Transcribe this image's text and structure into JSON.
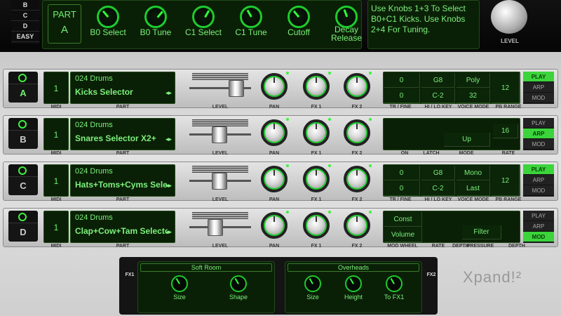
{
  "top": {
    "part_letters": [
      "B",
      "C",
      "D",
      "EASY"
    ],
    "part_label": "PART",
    "part_value": "A",
    "knobs": [
      {
        "label": "B0 Select",
        "angle": -40
      },
      {
        "label": "B0 Tune",
        "angle": 40
      },
      {
        "label": "C1 Select",
        "angle": 30
      },
      {
        "label": "C1 Tune",
        "angle": -30
      },
      {
        "label": "Cutoff",
        "angle": -40
      },
      {
        "label": "Decay\nRelease",
        "angle": -20
      }
    ],
    "message": "Use Knobs 1+3 To Select B0+C1 Kicks. Use Knobs 2+4 For Tuning.",
    "level_label": "LEVEL"
  },
  "rows": [
    {
      "letter": "A",
      "active": true,
      "midi": "1",
      "bank": "024 Drums",
      "part": "Kicks Selector",
      "mode": "play",
      "ctl": {
        "type": "play",
        "tr": [
          "0",
          "0"
        ],
        "hilo": [
          "G8",
          "C-2"
        ],
        "voice": [
          "Poly",
          "32"
        ],
        "pb": "12"
      },
      "labels": {
        "a": "TR / FINE",
        "b": "HI / LO KEY",
        "c": "VOICE MODE",
        "d": "PB RANGE"
      }
    },
    {
      "letter": "B",
      "active": false,
      "midi": "1",
      "bank": "024 Drums",
      "part": "Snares Selector X2+",
      "mode": "arp",
      "ctl": {
        "type": "arp",
        "arp_mode": "Up",
        "rate": "16"
      },
      "labels": {
        "a": "ON",
        "b": "LATCH",
        "c": "MODE",
        "d": "RATE"
      }
    },
    {
      "letter": "C",
      "active": false,
      "midi": "1",
      "bank": "024 Drums",
      "part": "Hats+Toms+Cyms Selector",
      "mode": "play",
      "ctl": {
        "type": "play",
        "tr": [
          "0",
          "0"
        ],
        "hilo": [
          "G8",
          "C-2"
        ],
        "voice": [
          "Mono",
          "Last"
        ],
        "pb": "12"
      },
      "labels": {
        "a": "TR / FINE",
        "b": "HI / LO KEY",
        "c": "VOICE MODE",
        "d": "PB RANGE"
      }
    },
    {
      "letter": "D",
      "active": false,
      "midi": "1",
      "bank": "024 Drums",
      "part": "Clap+Cow+Tam Selector",
      "mode": "mod",
      "ctl": {
        "type": "mod",
        "mw": [
          "Const",
          "Volume"
        ],
        "filter": "Filter"
      },
      "labels": {
        "a": "MOD WHEEL",
        "b": "RATE",
        "c": "DEPTH",
        "d": "PRESSURE",
        "e": "DEPTH"
      }
    }
  ],
  "strip_labels": {
    "midi": "MIDI",
    "part": "PART",
    "level": "LEVEL",
    "pan": "PAN",
    "fx1": "FX 1",
    "fx2": "FX 2"
  },
  "modes": [
    "PLAY",
    "ARP",
    "MOD"
  ],
  "fx": [
    {
      "tag": "FX1",
      "name": "Soft Room",
      "knobs": [
        "Size",
        "Shape"
      ]
    },
    {
      "tag": "FX2",
      "name": "Overheads",
      "knobs": [
        "Size",
        "Height",
        "To FX1"
      ]
    }
  ],
  "logo": "Xpand!²"
}
